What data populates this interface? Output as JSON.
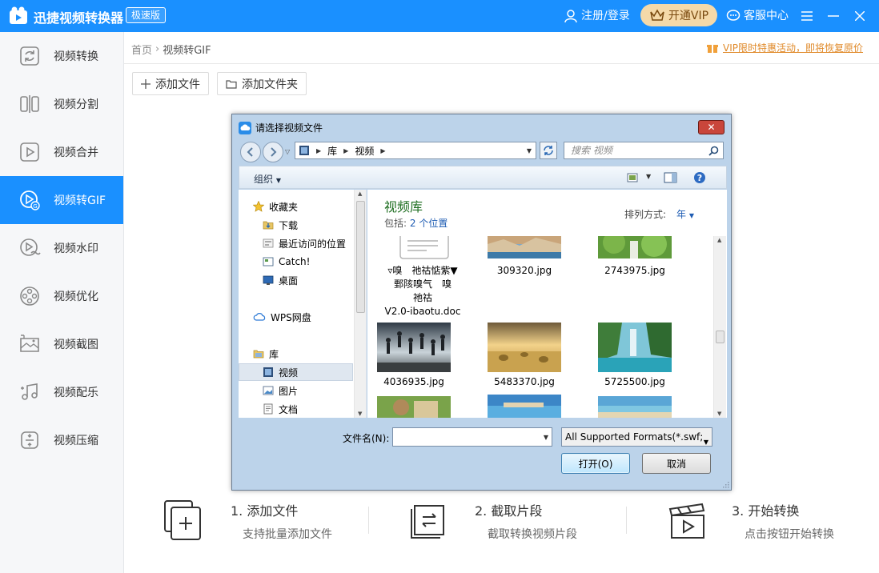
{
  "app": {
    "title": "迅捷视频转换器",
    "badge": "极速版",
    "login": "注册/登录",
    "vip": "开通VIP",
    "service": "客服中心"
  },
  "sidebar": {
    "items": [
      {
        "label": "视频转换",
        "icon": "convert-icon"
      },
      {
        "label": "视频分割",
        "icon": "split-icon"
      },
      {
        "label": "视频合并",
        "icon": "merge-icon"
      },
      {
        "label": "视频转GIF",
        "icon": "gif-icon",
        "active": true
      },
      {
        "label": "视频水印",
        "icon": "watermark-icon"
      },
      {
        "label": "视频优化",
        "icon": "optimize-icon"
      },
      {
        "label": "视频截图",
        "icon": "screenshot-icon"
      },
      {
        "label": "视频配乐",
        "icon": "music-icon"
      },
      {
        "label": "视频压缩",
        "icon": "compress-icon"
      }
    ]
  },
  "breadcrumb": {
    "home": "首页",
    "current": "视频转GIF"
  },
  "promo": "VIP限时特惠活动，即将恢复原价",
  "actions": {
    "add_file": "添加文件",
    "add_folder": "添加文件夹"
  },
  "steps": [
    {
      "title": "1.  添加文件",
      "desc": "支持批量添加文件"
    },
    {
      "title": "2.  截取片段",
      "desc": "截取转换视频片段"
    },
    {
      "title": "3.  开始转换",
      "desc": "点击按钮开始转换"
    }
  ],
  "dialog": {
    "title": "请选择视频文件",
    "address": [
      "库",
      "视频"
    ],
    "search_placeholder": "搜索 视频",
    "organize": "组织",
    "tree": [
      {
        "label": "收藏夹",
        "icon": "star-icon"
      },
      {
        "label": "下载",
        "icon": "download-folder-icon"
      },
      {
        "label": "最近访问的位置",
        "icon": "recent-icon"
      },
      {
        "label": "Catch!",
        "icon": "catch-icon"
      },
      {
        "label": "桌面",
        "icon": "desktop-icon"
      },
      {
        "label": "WPS网盘",
        "icon": "cloud-icon"
      },
      {
        "label": "库",
        "icon": "library-icon"
      },
      {
        "label": "视频",
        "icon": "video-folder-icon",
        "selected": true
      },
      {
        "label": "图片",
        "icon": "picture-folder-icon"
      },
      {
        "label": "文档",
        "icon": "document-folder-icon"
      }
    ],
    "library_title": "视频库",
    "library_includes_label": "包括:",
    "library_includes_link": "2 个位置",
    "sort_label": "排列方式:",
    "sort_value": "年",
    "doc_name": "▿嗅　祂祜惦紫▼\n鄄陔嗅气　嗅\n祂祜\nV2.0-ibaotu.doc",
    "files": [
      "309320.jpg",
      "2743975.jpg",
      "4036935.jpg",
      "5483370.jpg",
      "5725500.jpg"
    ],
    "filename_label": "文件名(N):",
    "filename_value": "",
    "format": "All Supported Formats(*.swf;",
    "open": "打开(O)",
    "cancel": "取消"
  }
}
